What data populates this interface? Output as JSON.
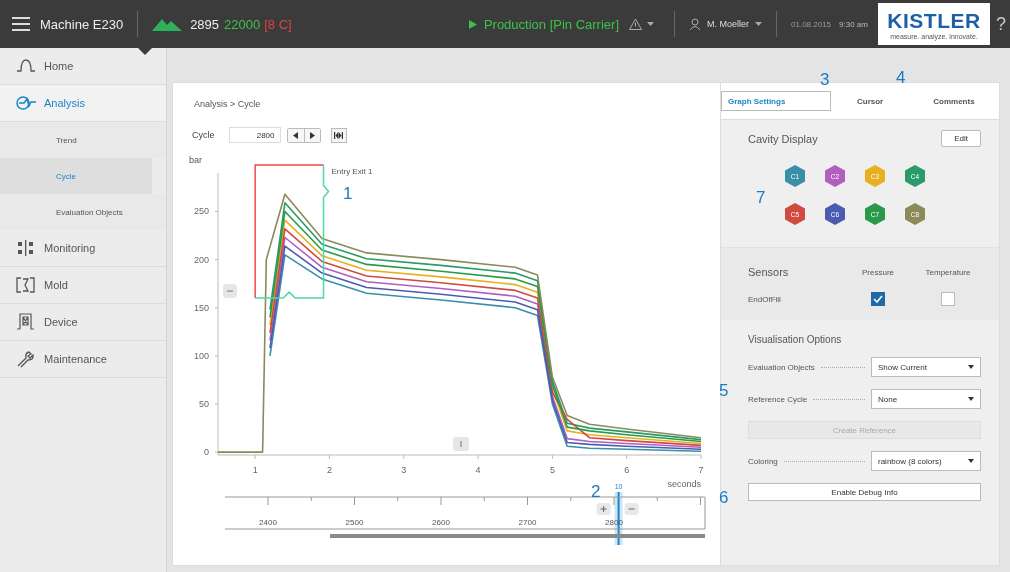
{
  "topbar": {
    "machine": "Machine E230",
    "counter": "2895",
    "target": "22000",
    "cavities_tag": "[8 C]",
    "status": "Production [Pin Carrier]",
    "user": "M. Moeller",
    "date": "01.08.2015",
    "time": "9:30 am",
    "logo": "KISTLER",
    "logo_tagline": "measure. analyze. innovate.",
    "help": "?"
  },
  "sidebar": {
    "items": [
      {
        "label": "Home",
        "kind": "main",
        "selected": false
      },
      {
        "label": "Analysis",
        "kind": "main",
        "selected": true
      },
      {
        "label": "Trend",
        "kind": "sub",
        "selected": false
      },
      {
        "label": "Cycle",
        "kind": "sub",
        "selected": true
      },
      {
        "label": "Evaluation Objects",
        "kind": "sub",
        "selected": false
      },
      {
        "label": "Monitoring",
        "kind": "main",
        "selected": false
      },
      {
        "label": "Mold",
        "kind": "main",
        "selected": false
      },
      {
        "label": "Device",
        "kind": "main",
        "selected": false
      },
      {
        "label": "Maintenance",
        "kind": "main",
        "selected": false
      }
    ]
  },
  "main": {
    "breadcrumb": "Analysis > Cycle",
    "cycle_label": "Cycle",
    "cycle_value": "2800",
    "chart_data": {
      "type": "line",
      "ylabel": "bar",
      "xlabel": "seconds",
      "xlim": [
        0.5,
        7
      ],
      "ylim": [
        -3,
        290
      ],
      "xticks": [
        1,
        2,
        3,
        4,
        5,
        6,
        7
      ],
      "yticks": [
        0,
        50,
        100,
        150,
        200,
        250
      ],
      "x": [
        0.5,
        1.0,
        1.1,
        1.15,
        1.2,
        1.4,
        1.9,
        2.5,
        3.5,
        4.5,
        4.8,
        5.0,
        5.2,
        5.5,
        6.0,
        7.0
      ],
      "series": [
        {
          "color": "#3a8fa8",
          "values": [
            null,
            null,
            null,
            null,
            100,
            205,
            180,
            165,
            158,
            150,
            142,
            50,
            6,
            4,
            3,
            1
          ]
        },
        {
          "color": "#b05fc0",
          "values": [
            null,
            null,
            null,
            null,
            116,
            223,
            192,
            177,
            170,
            162,
            154,
            58,
            14,
            11,
            9,
            5
          ]
        },
        {
          "color": "#e8b020",
          "values": [
            null,
            null,
            null,
            null,
            132,
            241,
            204,
            189,
            182,
            174,
            166,
            66,
            22,
            18,
            15,
            9
          ]
        },
        {
          "color": "#2a9a6a",
          "values": [
            null,
            null,
            null,
            null,
            148,
            259,
            216,
            201,
            194,
            186,
            178,
            74,
            30,
            25,
            21,
            13
          ]
        },
        {
          "color": "#d04a40",
          "values": [
            null,
            null,
            null,
            null,
            124,
            232,
            198,
            183,
            176,
            168,
            160,
            62,
            34,
            15,
            12,
            7
          ]
        },
        {
          "color": "#4a5cb0",
          "values": [
            null,
            null,
            null,
            null,
            108,
            214,
            186,
            171,
            164,
            156,
            148,
            54,
            10,
            8,
            6,
            3
          ]
        },
        {
          "color": "#2a9a4a",
          "values": [
            null,
            null,
            null,
            null,
            140,
            250,
            210,
            195,
            188,
            180,
            172,
            70,
            26,
            22,
            18,
            11
          ]
        },
        {
          "color": "#8a8a5a",
          "values": [
            0,
            0,
            0,
            200,
            null,
            268,
            222,
            207,
            200,
            192,
            184,
            78,
            38,
            29,
            24,
            15
          ]
        }
      ],
      "annotations": [
        "Entry Exit 1"
      ]
    },
    "timeline": {
      "ticks": [
        "2400",
        "2500",
        "2600",
        "2700",
        "2800"
      ],
      "marker_label": "10",
      "marker": {
        "level": 0.82
      }
    }
  },
  "panel": {
    "tabs": [
      {
        "label": "Graph Settings",
        "selected": true
      },
      {
        "label": "Cursor",
        "selected": false
      },
      {
        "label": "Comments",
        "selected": false
      }
    ],
    "cavity_title": "Cavity Display",
    "edit": "Edit",
    "cavities": [
      {
        "label": "C1",
        "color": "#3a8fa8"
      },
      {
        "label": "C2",
        "color": "#b05fc0"
      },
      {
        "label": "C3",
        "color": "#e8b020"
      },
      {
        "label": "C4",
        "color": "#2a9a6a"
      },
      {
        "label": "C5",
        "color": "#d04a40"
      },
      {
        "label": "C6",
        "color": "#4a5cb0"
      },
      {
        "label": "C7",
        "color": "#2a9a4a"
      },
      {
        "label": "C8",
        "color": "#8a8a5a"
      }
    ],
    "sensors_title": "Sensors",
    "sensor_columns": [
      "Pressure",
      "Temperature"
    ],
    "sensors": [
      {
        "name": "EndOfFill",
        "pressure": true,
        "temperature": false
      }
    ],
    "vis_title": "Visualisation Options",
    "options": [
      {
        "kind": "select",
        "label": "Evaluation Objects",
        "value": "Show Current"
      },
      {
        "kind": "select",
        "label": "Reference Cycle",
        "value": "None"
      },
      {
        "kind": "button",
        "label": "Create Reference",
        "disabled": true
      },
      {
        "kind": "select",
        "label": "Coloring",
        "value": "rainbow (8 colors)"
      },
      {
        "kind": "button",
        "label": "Enable Debug Info",
        "disabled": false
      }
    ]
  },
  "callouts": [
    {
      "label": "1"
    },
    {
      "label": "2"
    },
    {
      "label": "3"
    },
    {
      "label": "4"
    },
    {
      "label": "5"
    },
    {
      "label": "6"
    },
    {
      "label": "7"
    }
  ]
}
